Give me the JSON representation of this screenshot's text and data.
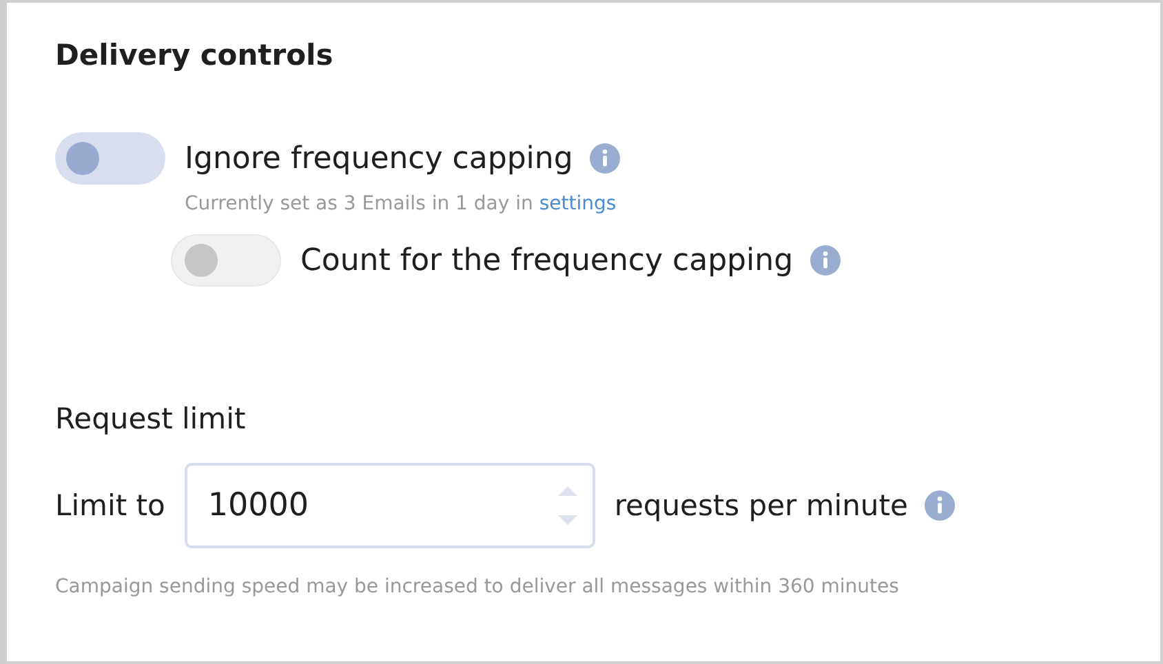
{
  "delivery_controls": {
    "title": "Delivery controls",
    "toggles": [
      {
        "label": "Ignore frequency capping",
        "on": false,
        "disabled": false,
        "hint": "Currently set as 3 Emails in 1 day in",
        "hint_link": "settings"
      },
      {
        "label": "Count for the frequency capping",
        "on": false,
        "disabled": true
      }
    ]
  },
  "request_limit": {
    "title": "Request limit",
    "prefix": "Limit to",
    "value": "10000",
    "suffix": "requests per minute",
    "note": "Campaign sending speed may be increased to deliver all messages within 360 minutes"
  }
}
